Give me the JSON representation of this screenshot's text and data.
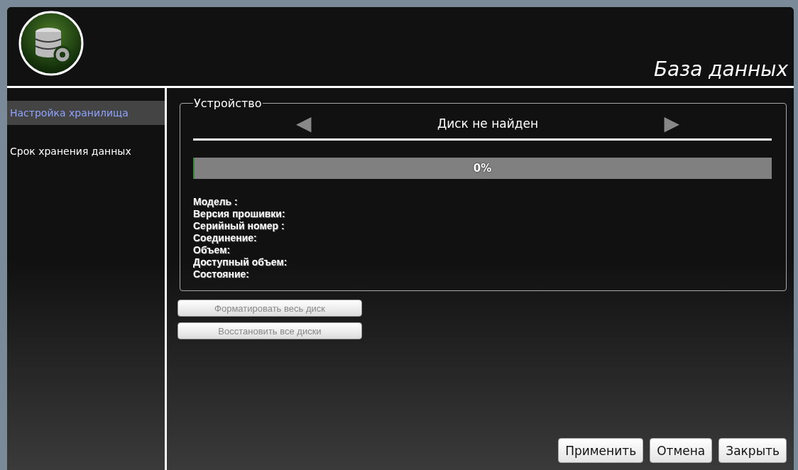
{
  "window": {
    "title": "База данных"
  },
  "sidebar": {
    "items": [
      {
        "label": "Настройка хранилища",
        "selected": true
      },
      {
        "label": "Срок хранения данных",
        "selected": false
      }
    ]
  },
  "device": {
    "legend": "Устройство",
    "prev": "◀",
    "next": "▶",
    "disk": "Диск не найден",
    "progress": {
      "level": 0,
      "reading": "0%"
    },
    "fields": [
      "Модель :",
      "Версия прошивки:",
      "Серийный номер :",
      "Соединение:",
      "Объем:",
      "Доступный объем:",
      "Состояние:"
    ]
  },
  "actions": [
    {
      "label": "Форматировать весь диск",
      "disabled": true
    },
    {
      "label": "Восстановить все диски",
      "disabled": true
    }
  ],
  "buttons": [
    "Применить",
    "Отмена",
    "Закрыть"
  ]
}
